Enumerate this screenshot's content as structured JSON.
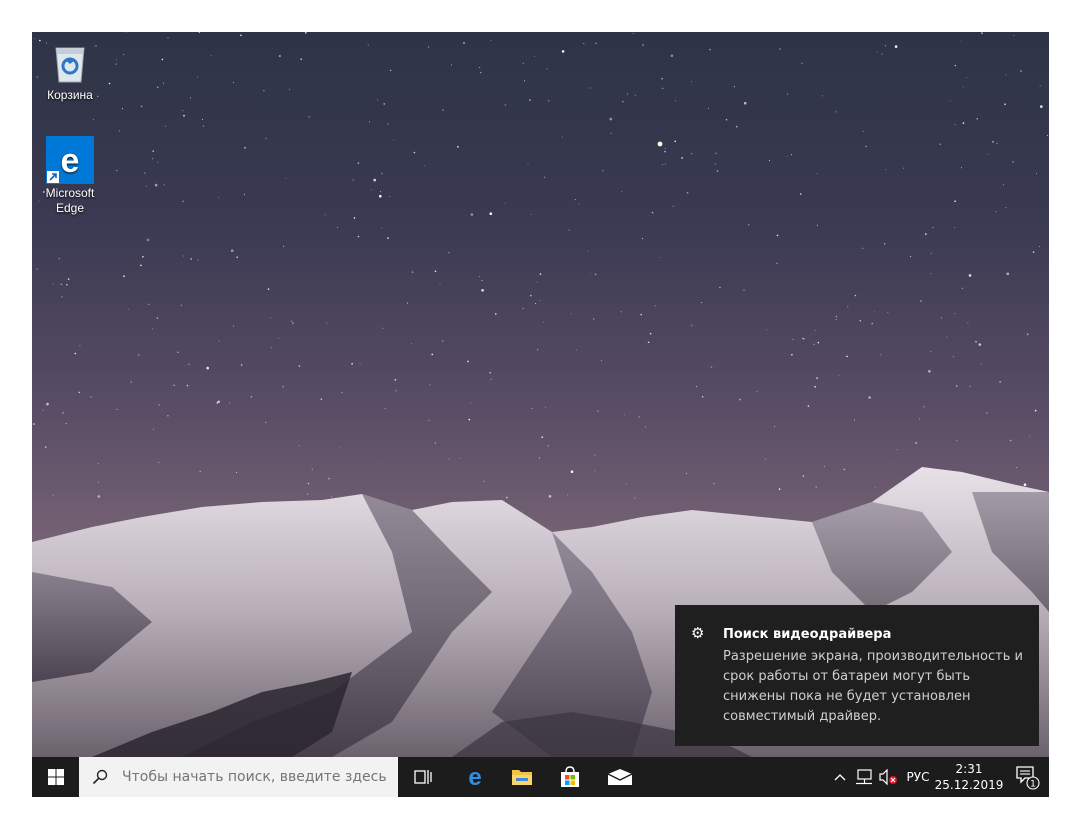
{
  "desktop": {
    "icons": [
      {
        "label": "Корзина",
        "icon": "recycle-bin-icon"
      },
      {
        "label": "Microsoft Edge",
        "icon": "edge-icon"
      }
    ]
  },
  "notification": {
    "icon": "gear-icon",
    "title": "Поиск видеодрайвера",
    "body": "Разрешение экрана, производительность и срок работы от батареи могут быть снижены пока не будет установлен совместимый драйвер."
  },
  "taskbar": {
    "search_placeholder": "Чтобы начать поиск, введите здесь",
    "pinned": [
      "task-view-icon",
      "edge-icon",
      "file-explorer-icon",
      "store-icon",
      "mail-icon"
    ],
    "tray": {
      "language": "РУС",
      "time": "2:31",
      "date": "25.12.2019",
      "notification_count": "1"
    }
  },
  "colors": {
    "taskbar": "#1c1c1c",
    "accent": "#0078d7",
    "toast": "#1f1f1f"
  }
}
